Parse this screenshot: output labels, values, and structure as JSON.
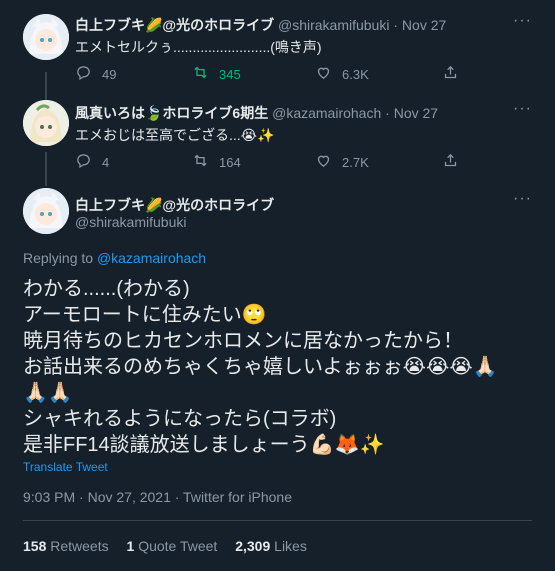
{
  "tweet1": {
    "name": "白上フブキ🌽@光のホロライブ",
    "handle": "@shirakamifubuki",
    "dot": "·",
    "date": "Nov 27",
    "text": "エメトセルクぅ.........................(鳴き声)",
    "reply_count": "49",
    "retweet_count": "345",
    "like_count": "6.3K"
  },
  "tweet2": {
    "name": "風真いろは🍃ホロライブ6期生",
    "handle": "@kazamairohach",
    "dot": "·",
    "date": "Nov 27",
    "text": "エメおじは至高でござる...😭✨",
    "reply_count": "4",
    "retweet_count": "164",
    "like_count": "2.7K"
  },
  "main_tweet": {
    "name": "白上フブキ🌽@光のホロライブ",
    "handle": "@shirakamifubuki",
    "replying_prefix": "Replying to",
    "replying_to": "@kazamairohach",
    "lines": [
      "わかる......(わかる)",
      "アーモロートに住みたい🙄",
      "暁月待ちのヒカセンホロメンに居なかったから！",
      "お話出来るのめちゃくちゃ嬉しいよぉぉぉ😭😭😭🙏🏻",
      "🙏🏻🙏🏻",
      "シャキれるようになったら(コラボ)",
      "是非FF14談議放送しましょーう💪🏻🦊✨"
    ],
    "translate": "Translate Tweet",
    "meta": "9:03 PM · Nov 27, 2021 · Twitter for iPhone",
    "retweets_count": "158",
    "retweets_label": "Retweets",
    "quotes_count": "1",
    "quotes_label": "Quote Tweet",
    "likes_count": "2,309",
    "likes_label": "Likes"
  },
  "icons": {
    "reply": "comment-icon",
    "retweet": "retweet-icon",
    "like": "heart-icon",
    "share": "share-icon",
    "more": "more-icon"
  },
  "colors": {
    "background": "#15202b",
    "retweet_active": "#00ba7c",
    "link": "#1d9bf0"
  }
}
